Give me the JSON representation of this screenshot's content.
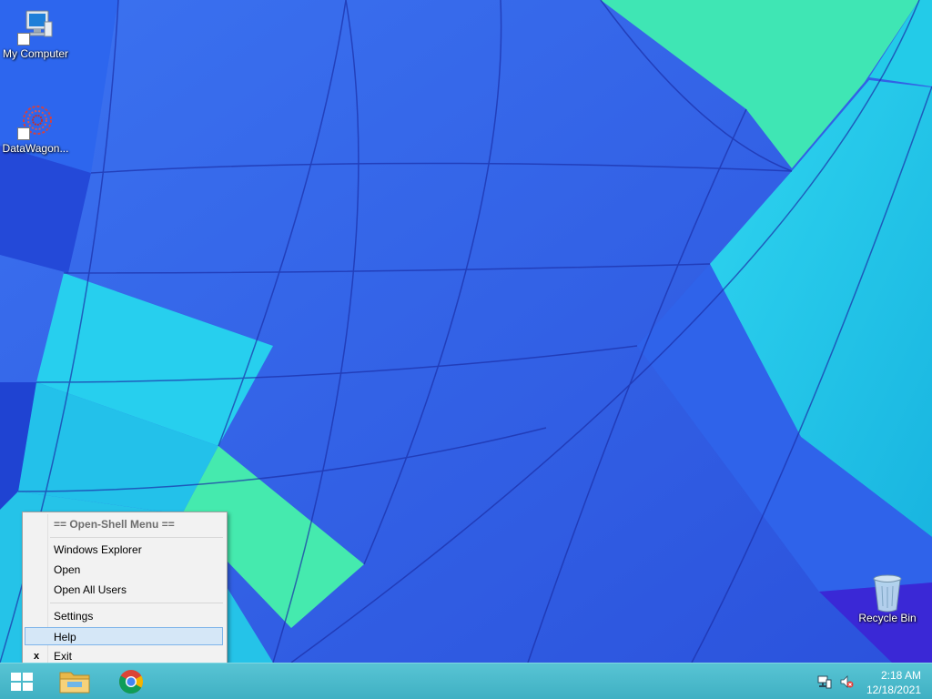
{
  "desktop": {
    "icons": [
      {
        "label": "My Computer",
        "icon": "computer-icon"
      },
      {
        "label": "DataWagon...",
        "icon": "datawagon-icon"
      },
      {
        "label": "Recycle Bin",
        "icon": "recycle-bin-icon"
      }
    ]
  },
  "context_menu": {
    "header": "== Open-Shell Menu ==",
    "items": [
      {
        "label": "Windows Explorer"
      },
      {
        "label": "Open"
      },
      {
        "label": "Open All Users"
      },
      {
        "label": "Settings"
      },
      {
        "label": "Help",
        "highlighted": true
      },
      {
        "label": "Exit",
        "mark": "x"
      }
    ]
  },
  "taskbar": {
    "start_icon": "windows-start-icon",
    "pinned": [
      {
        "name": "File Explorer",
        "icon": "file-explorer-icon"
      },
      {
        "name": "Google Chrome",
        "icon": "chrome-icon"
      }
    ],
    "tray": {
      "network_icon": "network-icon",
      "volume_icon": "volume-muted-icon",
      "time": "2:18 AM",
      "date": "12/18/2021"
    }
  },
  "colors": {
    "wallpaper_blue": "#2e5fe6",
    "wallpaper_cyan": "#22c9e8",
    "wallpaper_green": "#4af0a8",
    "taskbar": "#4bbccc",
    "menu_highlight": "#d5e7f7"
  }
}
